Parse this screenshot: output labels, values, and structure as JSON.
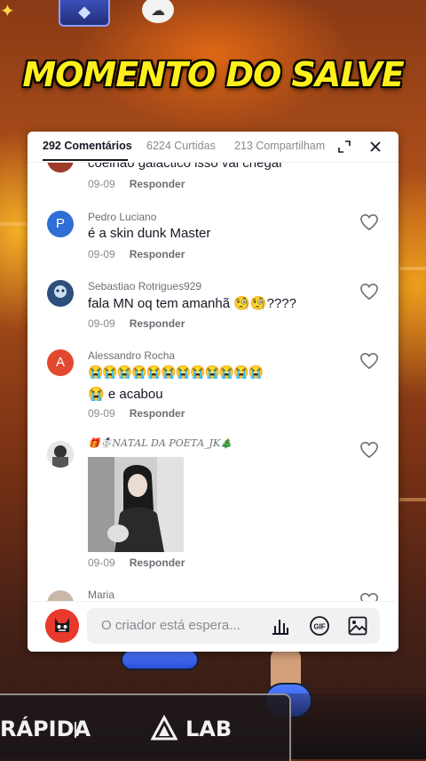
{
  "video": {
    "banner_text": "MOMENTO DO SALVE",
    "mode_left": "RÁPIDA",
    "mode_right": "LAB"
  },
  "comments_panel": {
    "tabs": [
      {
        "label": "292 Comentários",
        "active": true
      },
      {
        "label": "6224 Curtidas",
        "active": false
      },
      {
        "label": "213 Compartilham",
        "active": false
      }
    ],
    "reply_label": "Responder",
    "comments": [
      {
        "name": "",
        "text": "coelhão galáctico isso vai chegar",
        "date": "09-09",
        "avatar": "photo"
      },
      {
        "name": "Pedro Luciano",
        "text": "é a skin dunk Master",
        "date": "09-09",
        "avatar_letter": "P",
        "avatar_color": "#2f6fd6"
      },
      {
        "name": "Sebastiao Rotrigues929",
        "text": "fala MN oq tem amanhã 🧐🧐????",
        "date": "09-09",
        "avatar": "photo"
      },
      {
        "name": "Alessandro Rocha",
        "text_line1": "😭😭😭😭😭😭😭😭😭😭😭😭",
        "text_line2": "😭 e acabou",
        "date": "09-09",
        "avatar_letter": "A",
        "avatar_color": "#e2482f"
      },
      {
        "name": "🎁☃️𝑁𝐴𝑇𝐴𝐿 𝐷𝐴 𝑃𝑂𝐸𝑇𝐴_𝐽𝐾🎄",
        "text": "",
        "date": "09-09",
        "avatar": "photo",
        "has_image": true
      },
      {
        "name": "Maria",
        "text": "",
        "date": "",
        "avatar": "photo"
      }
    ],
    "input_placeholder": "O criador está espera..."
  },
  "colors": {
    "banner_yellow": "#ffef1a",
    "panel_bg": "#ffffff",
    "text_primary": "#161823",
    "text_secondary": "#8a8b91"
  }
}
